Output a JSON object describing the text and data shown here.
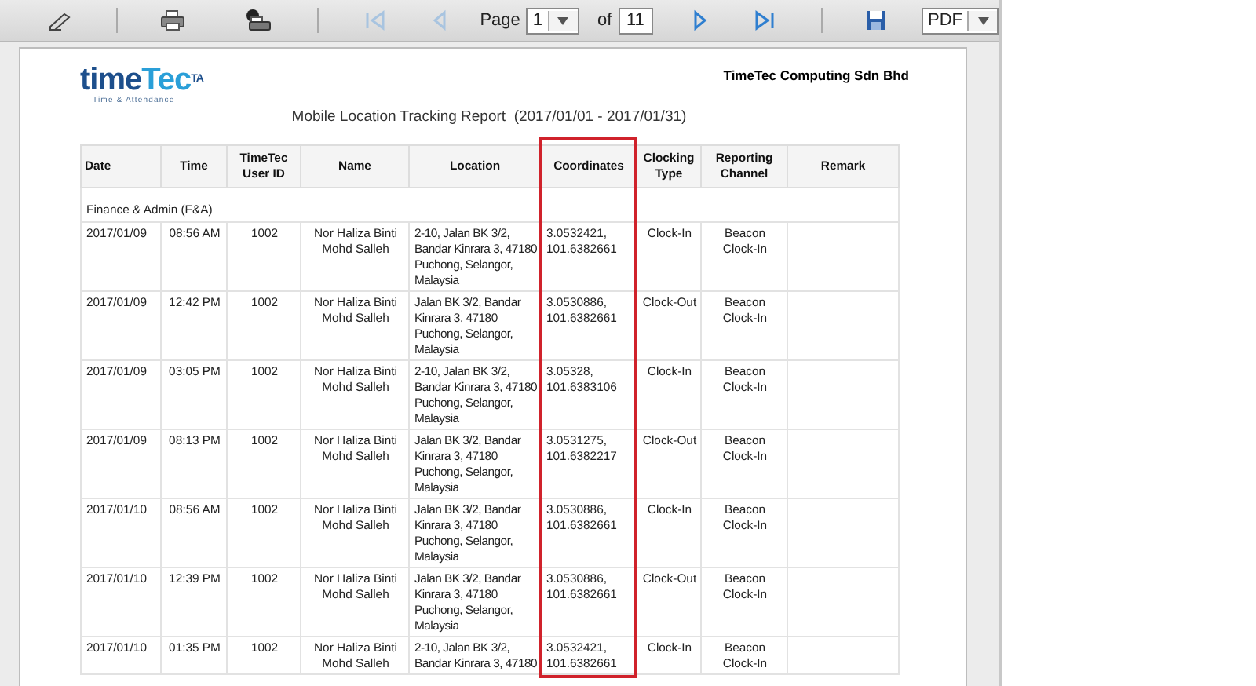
{
  "toolbar": {
    "page_label": "Page",
    "page_value": "1",
    "of_label": "of",
    "page_count": "11",
    "export_format": "PDF",
    "nav": [
      {
        "kind": "first",
        "disabled": true
      },
      {
        "kind": "prev",
        "disabled": true
      },
      {
        "kind": "next",
        "disabled": false
      },
      {
        "kind": "last",
        "disabled": false
      }
    ]
  },
  "report": {
    "logo": {
      "parts": [
        "time",
        "Tec"
      ],
      "badge": "TA",
      "tagline": "Time & Attendance"
    },
    "company": "TimeTec Computing Sdn Bhd",
    "title": "Mobile Location Tracking Report  (2017/01/01 - 2017/01/31)",
    "columns": [
      {
        "label": "Date",
        "highlighted": false
      },
      {
        "label": "Time",
        "highlighted": false
      },
      {
        "label": "TimeTec User ID",
        "highlighted": false
      },
      {
        "label": "Name",
        "highlighted": false
      },
      {
        "label": "Location",
        "highlighted": false
      },
      {
        "label": "Coordinates",
        "highlighted": true
      },
      {
        "label": "Clocking Type",
        "highlighted": false
      },
      {
        "label": "Reporting Channel",
        "highlighted": false
      },
      {
        "label": "Remark",
        "highlighted": false
      }
    ],
    "group": "Finance & Admin (F&A)",
    "rows": [
      {
        "cells": [
          "2017/01/09",
          "08:56 AM",
          "1002",
          "Nor Haliza Binti Mohd Salleh",
          "2-10, Jalan BK 3/2, Bandar Kinrara 3, 47180 Puchong, Selangor, Malaysia",
          "3.0532421, 101.6382661",
          "Clock-In",
          "Beacon Clock-In"
        ]
      },
      {
        "cells": [
          "2017/01/09",
          "12:42 PM",
          "1002",
          "Nor Haliza Binti Mohd Salleh",
          "Jalan BK 3/2, Bandar Kinrara 3, 47180 Puchong, Selangor, Malaysia",
          "3.0530886, 101.6382661",
          "Clock-Out",
          "Beacon Clock-In"
        ]
      },
      {
        "cells": [
          "2017/01/09",
          "03:05 PM",
          "1002",
          "Nor Haliza Binti Mohd Salleh",
          "2-10, Jalan BK 3/2, Bandar Kinrara 3, 47180 Puchong, Selangor, Malaysia",
          "3.05328, 101.6383106",
          "Clock-In",
          "Beacon Clock-In"
        ]
      },
      {
        "cells": [
          "2017/01/09",
          "08:13 PM",
          "1002",
          "Nor Haliza Binti Mohd Salleh",
          "Jalan BK 3/2, Bandar Kinrara 3, 47180 Puchong, Selangor, Malaysia",
          "3.0531275, 101.6382217",
          "Clock-Out",
          "Beacon Clock-In"
        ]
      },
      {
        "cells": [
          "2017/01/10",
          "08:56 AM",
          "1002",
          "Nor Haliza Binti Mohd Salleh",
          "Jalan BK 3/2, Bandar Kinrara 3, 47180 Puchong, Selangor, Malaysia",
          "3.0530886, 101.6382661",
          "Clock-In",
          "Beacon Clock-In"
        ]
      },
      {
        "cells": [
          "2017/01/10",
          "12:39 PM",
          "1002",
          "Nor Haliza Binti Mohd Salleh",
          "Jalan BK 3/2, Bandar Kinrara 3, 47180 Puchong, Selangor, Malaysia",
          "3.0530886, 101.6382661",
          "Clock-Out",
          "Beacon Clock-In"
        ]
      },
      {
        "cells": [
          "2017/01/10",
          "01:35 PM",
          "1002",
          "Nor Haliza Binti Mohd Salleh",
          "2-10, Jalan BK 3/2, Bandar Kinrara 3, 47180",
          "3.0532421, 101.6382661",
          "Clock-In",
          "Beacon Clock-In"
        ]
      }
    ]
  }
}
